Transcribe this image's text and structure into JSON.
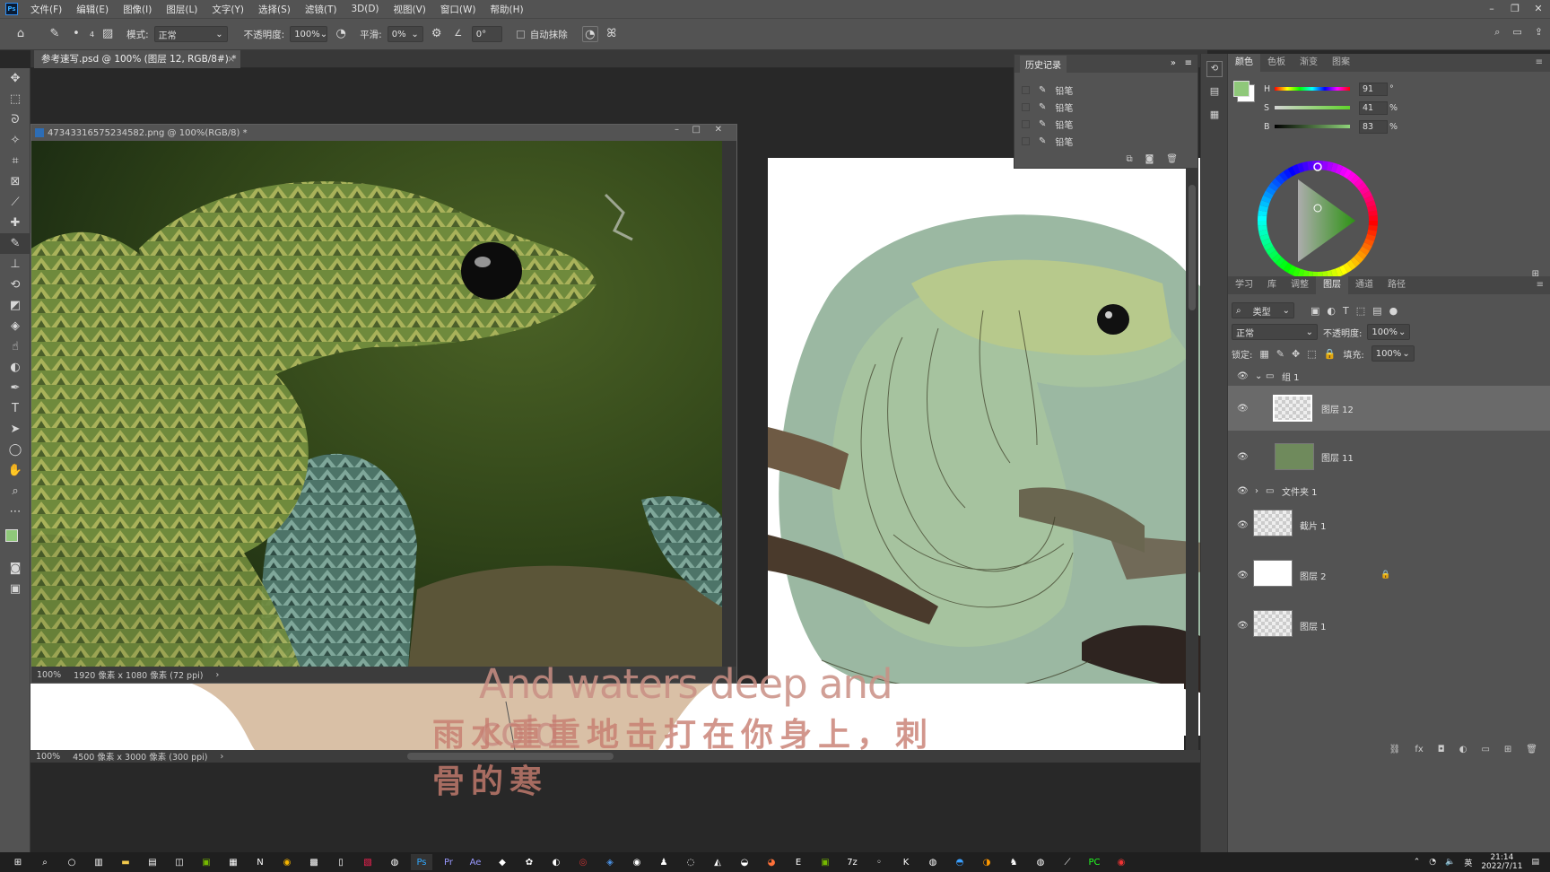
{
  "menubar": {
    "logo": "Ps",
    "items": [
      "文件(F)",
      "编辑(E)",
      "图像(I)",
      "图层(L)",
      "文字(Y)",
      "选择(S)",
      "滤镜(T)",
      "3D(D)",
      "视图(V)",
      "窗口(W)",
      "帮助(H)"
    ]
  },
  "options": {
    "brush_size": "4",
    "mode_label": "模式:",
    "mode_value": "正常",
    "opacity_label": "不透明度:",
    "opacity_value": "100%",
    "smooth_label": "平滑:",
    "smooth_value": "0%",
    "angle_value": "0°",
    "auto_erase_label": "自动抹除"
  },
  "document": {
    "tab_title": "参考速写.psd @ 100% (图层 12, RGB/8#) *",
    "zoom": "100%",
    "size_info": "4500 像素 x 3000 像素 (300 ppi)"
  },
  "photo_window": {
    "title": "473433165752345​82.png @ 100%(RGB/8) *",
    "zoom": "100%",
    "size_info": "1920 像素 x 1080 像素 (72 ppi)"
  },
  "subtitles": {
    "english": "And waters deep and cold",
    "chinese": "雨水重重地击打在你身上，刺骨的寒"
  },
  "history": {
    "title": "历史记录",
    "items": [
      "铅笔",
      "铅笔",
      "铅笔",
      "铅笔"
    ]
  },
  "color_panel": {
    "tabs": [
      "颜色",
      "色板",
      "渐变",
      "图案"
    ],
    "h": {
      "label": "H",
      "value": "91",
      "unit": "°"
    },
    "s": {
      "label": "S",
      "value": "41",
      "unit": "%"
    },
    "b": {
      "label": "B",
      "value": "83",
      "unit": "%"
    },
    "foreground": "#8fc87a",
    "background": "#ffffff"
  },
  "layers_panel": {
    "tabs": [
      "学习",
      "库",
      "调整",
      "图层",
      "通道",
      "路径"
    ],
    "filter_label": "类型",
    "blend_mode": "正常",
    "opacity_label": "不透明度:",
    "opacity_value": "100%",
    "lock_label": "锁定:",
    "fill_label": "填充:",
    "fill_value": "100%",
    "layers": [
      {
        "name": "组 1",
        "type": "group"
      },
      {
        "name": "图层 12",
        "type": "layer"
      },
      {
        "name": "图层 11",
        "type": "layer"
      },
      {
        "name": "文件夹 1",
        "type": "group"
      },
      {
        "name": "截片 1",
        "type": "layer"
      },
      {
        "name": "图层 2",
        "type": "layer"
      },
      {
        "name": "图层 1",
        "type": "layer"
      }
    ]
  },
  "taskbar": {
    "time": "21:14",
    "date": "2022/7/11",
    "ime": "英"
  }
}
